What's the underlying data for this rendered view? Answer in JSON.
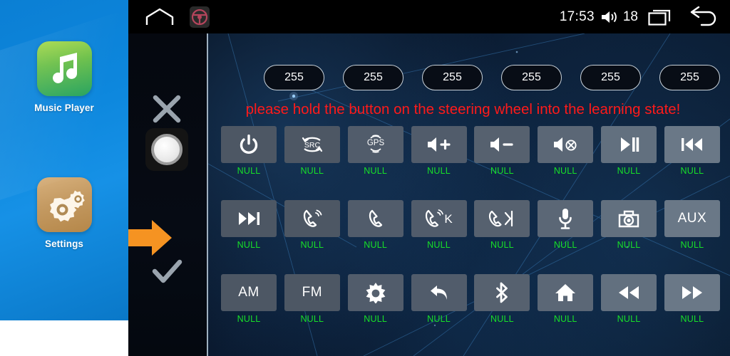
{
  "sidebar": {
    "apps": [
      {
        "label": "Music Player",
        "icon": "music-note-icon",
        "color": "#57b94f"
      },
      {
        "label": "Settings",
        "icon": "gears-icon",
        "color": "#c49a62"
      }
    ]
  },
  "statusbar": {
    "home_icon": "home-outline-icon",
    "wheel_icon": "steering-wheel-icon",
    "time": "17:53",
    "volume_icon": "speaker-icon",
    "volume_level": "18",
    "recents_icon": "recents-icon",
    "back_icon": "back-arrow-icon"
  },
  "controls": {
    "cancel_icon": "close-x-icon",
    "confirm_icon": "check-icon",
    "knob_icon": "rotary-knob-icon",
    "pointer_icon": "orange-arrow-icon"
  },
  "channels": {
    "values": [
      "255",
      "255",
      "255",
      "255",
      "255",
      "255"
    ]
  },
  "warning": {
    "text": "please hold the button on the steering wheel into the learning state!",
    "color": "#ff1a1a"
  },
  "grid": {
    "unassigned_label": "NULL",
    "label_color": "#17e028",
    "rows": [
      [
        {
          "icon": "power-icon",
          "label": "NULL"
        },
        {
          "icon": "src-icon",
          "text": "SRC",
          "label": "NULL"
        },
        {
          "icon": "gps-icon",
          "text": "GPS",
          "label": "NULL"
        },
        {
          "icon": "volume-up-icon",
          "label": "NULL"
        },
        {
          "icon": "volume-down-icon",
          "label": "NULL"
        },
        {
          "icon": "mute-icon",
          "label": "NULL"
        },
        {
          "icon": "play-pause-icon",
          "label": "NULL"
        },
        {
          "icon": "previous-track-icon",
          "label": "NULL"
        }
      ],
      [
        {
          "icon": "next-track-icon",
          "label": "NULL"
        },
        {
          "icon": "phone-answer-icon",
          "label": "NULL"
        },
        {
          "icon": "phone-hangup-icon",
          "label": "NULL"
        },
        {
          "icon": "phone-answer-k-icon",
          "label": "NULL"
        },
        {
          "icon": "phone-hangup-arrow-icon",
          "label": "NULL"
        },
        {
          "icon": "microphone-icon",
          "label": "NULL"
        },
        {
          "icon": "camera-icon",
          "label": "NULL"
        },
        {
          "icon": "aux-icon",
          "text": "AUX",
          "label": "NULL"
        }
      ],
      [
        {
          "icon": "am-icon",
          "text": "AM",
          "label": "NULL"
        },
        {
          "icon": "fm-icon",
          "text": "FM",
          "label": "NULL"
        },
        {
          "icon": "brightness-icon",
          "label": "NULL"
        },
        {
          "icon": "return-arrow-icon",
          "label": "NULL"
        },
        {
          "icon": "bluetooth-icon",
          "label": "NULL"
        },
        {
          "icon": "home-icon",
          "label": "NULL"
        },
        {
          "icon": "rewind-icon",
          "label": "NULL"
        },
        {
          "icon": "fast-forward-icon",
          "label": "NULL"
        }
      ]
    ]
  }
}
